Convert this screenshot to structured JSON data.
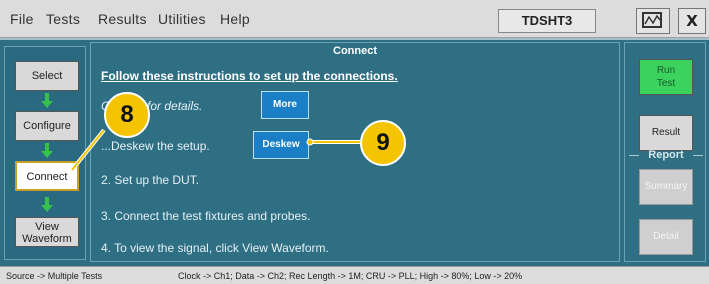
{
  "menu": {
    "items": [
      "File",
      "Tests",
      "Results",
      "Utilities",
      "Help"
    ],
    "app_title": "TDSHT3"
  },
  "window_controls": {
    "close_label": "X"
  },
  "left_nav": {
    "select": "Select",
    "configure": "Configure",
    "connect": "Connect",
    "view_waveform_line1": "View",
    "view_waveform_line2": "Waveform"
  },
  "center": {
    "title": "Connect",
    "instructions_heading": "Follow these instructions to set up the connections.",
    "step_details": "C... ...re for details.",
    "more_button": "More",
    "step1": "...Deskew the setup.",
    "deskew_button": "Deskew",
    "step2": "2. Set up the DUT.",
    "step3": "3. Connect the test fixtures and probes.",
    "step4": "4. To view the signal, click View Waveform."
  },
  "callouts": {
    "first": "8",
    "second": "9"
  },
  "right_panel": {
    "run_test_line1": "Run",
    "run_test_line2": "Test",
    "result": "Result",
    "report_label": "Report",
    "summary": "Summary",
    "detail": "Detail"
  },
  "status": {
    "source": "Source -> Multiple Tests",
    "config": "Clock -> Ch1; Data -> Ch2; Rec Length -> 1M; CRU -> PLL; High -> 80%; Low -> 20%"
  }
}
